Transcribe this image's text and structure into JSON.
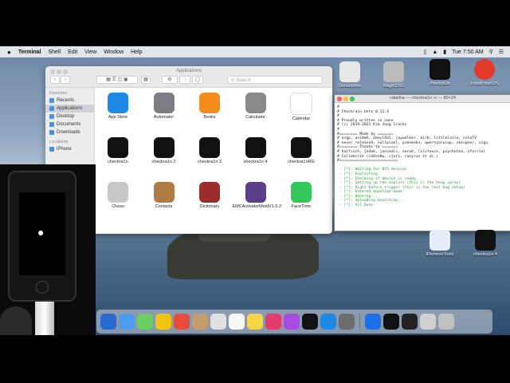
{
  "menubar": {
    "apple_glyph": "",
    "app_name": "Terminal",
    "items": [
      "Shell",
      "Edit",
      "View",
      "Window",
      "Help"
    ],
    "clock": "Tue 7:50 AM"
  },
  "finder": {
    "title": "Applications",
    "search_placeholder": "Search",
    "sidebar": {
      "favorites_header": "Favorites",
      "favorites": [
        "Recents",
        "Applications",
        "Desktop",
        "Documents",
        "Downloads"
      ],
      "locations_header": "Locations",
      "locations": [
        "iPhone"
      ]
    },
    "apps": [
      {
        "label": "App Store",
        "color": "#1e88e5"
      },
      {
        "label": "Automator",
        "color": "#7d7d85"
      },
      {
        "label": "Books",
        "color": "#f28c1b"
      },
      {
        "label": "Calculator",
        "color": "#8a8a8a"
      },
      {
        "label": "Calendar",
        "color": "#ffffff"
      },
      {
        "label": "checkra1n",
        "color": "#111111"
      },
      {
        "label": "checkra1n 2",
        "color": "#111111"
      },
      {
        "label": "checkra1n 3",
        "color": "#111111"
      },
      {
        "label": "checkra1n 4",
        "color": "#111111"
      },
      {
        "label": "checkra1nRG",
        "color": "#111111"
      },
      {
        "label": "Chess",
        "color": "#c9c9c9"
      },
      {
        "label": "Contacts",
        "color": "#b07a45"
      },
      {
        "label": "Dictionary",
        "color": "#9b2d2d"
      },
      {
        "label": "EMCActivatorMeidV1.5.2",
        "color": "#5b3f8c"
      },
      {
        "label": "FaceTime",
        "color": "#34c759"
      }
    ],
    "calendar_day": "17"
  },
  "terminal": {
    "title": "catalina — checkra1n -c — 80×24",
    "lines": [
      "#",
      "# Checkra1n beta 0.12.4",
      "#",
      "# Proudly written in nano",
      "# (c) 2019-2021 Kim Jong Cracks",
      "#",
      "#======== Made by =======",
      "# argp, axi0mX, danyl931, jaywalker, kirb, littlelailo, nitoTV",
      "# never_released, nullpixel, pimskeks, qwertyoruiop, sbingner, sigu",
      "#======== Thanks to =======",
      "# haifisch, jndok, jonseals, xerub, lilstevie, psychotea, sferrini",
      "# Cellebrite (ih8sn0w, cjori, ronyrus et al.)",
      "#==========================",
      "",
      " - [*]: Waiting for DFU devices",
      " - [*]: Exploiting",
      " - [*]: Checking if device is ready",
      " - [*]: Setting up the exploit (this is the heap spray)",
      " - [*]: Right before trigger (this is the real bug setup)",
      " - [*]: Entered download mode",
      " - [*]: Booting...",
      " - [*]: Uploading bootstrap...",
      " - [*]: All Done"
    ]
  },
  "desktop_icons": [
    {
      "label": "Documents"
    },
    {
      "label": "MagicCFG"
    },
    {
      "label": "checkra1n"
    },
    {
      "label": "Install macOS"
    },
    {
      "label": "iRemoveTools"
    },
    {
      "label": "checkra1n 4"
    }
  ],
  "dock_colors": [
    "#2a6bd1",
    "#4c9cf0",
    "#6ccf64",
    "#f1c40f",
    "#e74c3c",
    "#c69c6d",
    "#e0e0e0",
    "#f7f7f7",
    "#f5d547",
    "#e53d6b",
    "#a64ce0",
    "#111111",
    "#1e88e5",
    "#6d6d6d",
    "#1d6fe8",
    "#111111",
    "#222222",
    "#d0d0d0",
    "#c0c0c0"
  ]
}
